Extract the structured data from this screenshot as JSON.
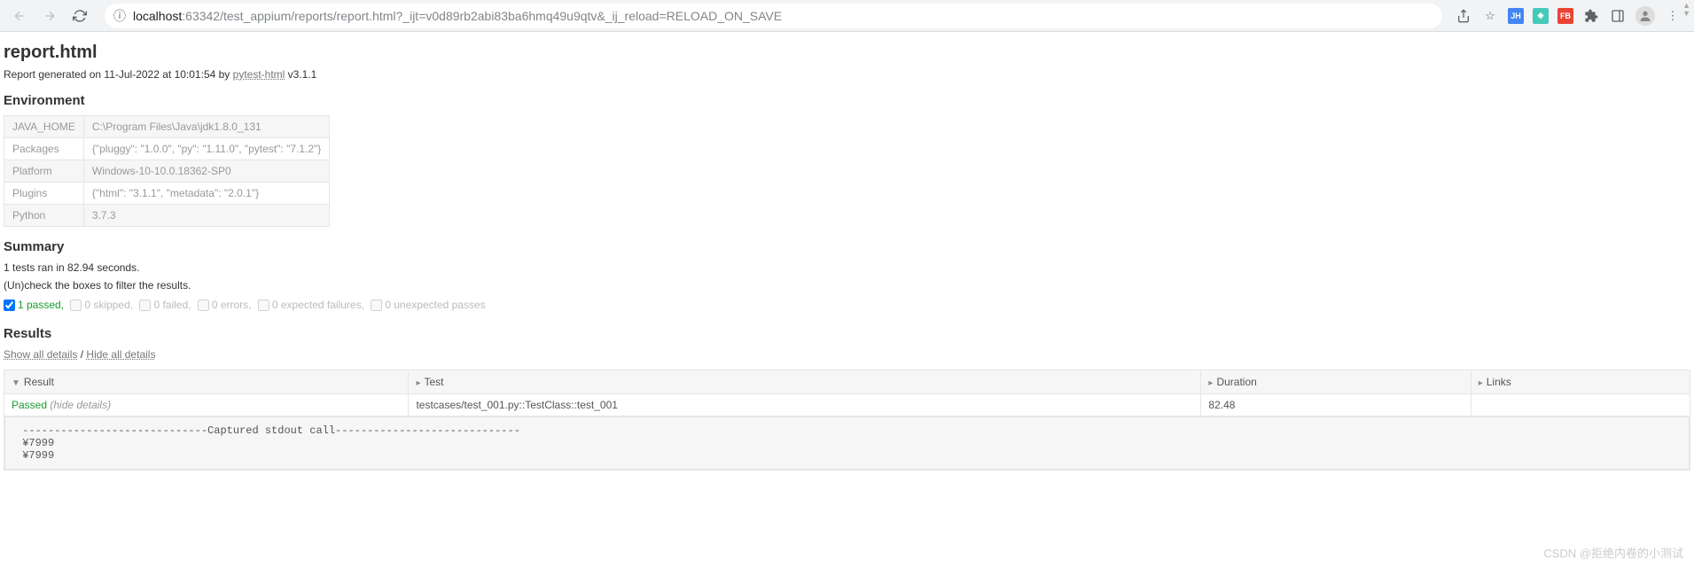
{
  "browser": {
    "url_host": "localhost",
    "url_port": ":63342",
    "url_path": "/test_appium/reports/report.html?_ijt=v0d89rb2abi83ba6hmq49u9qtv&_ij_reload=RELOAD_ON_SAVE",
    "ext1": "JH",
    "ext3": "FB"
  },
  "page_title": "report.html",
  "generated_prefix": "Report generated on 11-Jul-2022 at 10:01:54 by ",
  "generator_link": "pytest-html",
  "generator_version": " v3.1.1",
  "environment_heading": "Environment",
  "env": [
    {
      "key": "JAVA_HOME",
      "value": "C:\\Program Files\\Java\\jdk1.8.0_131"
    },
    {
      "key": "Packages",
      "value": "{\"pluggy\": \"1.0.0\", \"py\": \"1.11.0\", \"pytest\": \"7.1.2\"}"
    },
    {
      "key": "Platform",
      "value": "Windows-10-10.0.18362-SP0"
    },
    {
      "key": "Plugins",
      "value": "{\"html\": \"3.1.1\", \"metadata\": \"2.0.1\"}"
    },
    {
      "key": "Python",
      "value": "3.7.3"
    }
  ],
  "summary_heading": "Summary",
  "tests_ran": "1 tests ran in 82.94 seconds.",
  "filter_hint": "(Un)check the boxes to filter the results.",
  "filters": {
    "passed": "1 passed,",
    "skipped": "0 skipped,",
    "failed": "0 failed,",
    "errors": "0 errors,",
    "expected_failures": "0 expected failures,",
    "unexpected_passes": "0 unexpected passes"
  },
  "results_heading": "Results",
  "show_all": "Show all details",
  "hide_all": "Hide all details",
  "separator": " / ",
  "columns": {
    "result": "Result",
    "test": "Test",
    "duration": "Duration",
    "links": "Links"
  },
  "row": {
    "result": "Passed",
    "hide": " (hide details)",
    "test": "testcases/test_001.py::TestClass::test_001",
    "duration": "82.48",
    "links": ""
  },
  "stdout": " -----------------------------Captured stdout call-----------------------------\n ¥7999\n ¥7999",
  "watermark": "CSDN @拒绝内卷的小测试"
}
